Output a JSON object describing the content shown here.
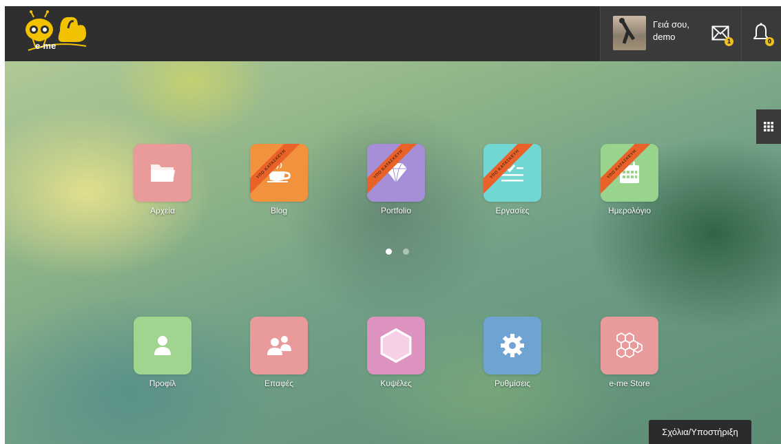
{
  "app": {
    "logo_text": "e-me"
  },
  "header": {
    "greeting_line1": "Γειά σου,",
    "greeting_line2": "demo",
    "mail_count": "1",
    "notif_count": "0"
  },
  "ribbon_text": "ΥΠΟ ΚΑΤΑΣΚΕΥΗ",
  "apps_row1": [
    {
      "label": "Αρχεία",
      "icon": "folder-icon",
      "color": "#e99b9b",
      "ribbon": false
    },
    {
      "label": "Blog",
      "icon": "coffee-cup-icon",
      "color": "#f3923d",
      "ribbon": true
    },
    {
      "label": "Portfolio",
      "icon": "diamond-icon",
      "color": "#a68fd6",
      "ribbon": true
    },
    {
      "label": "Εργασίες",
      "icon": "task-list-icon",
      "color": "#72d6d3",
      "ribbon": true
    },
    {
      "label": "Ημερολόγιο",
      "icon": "calendar-icon",
      "color": "#98d48d",
      "ribbon": true
    }
  ],
  "apps_row2": [
    {
      "label": "Προφίλ",
      "icon": "user-icon",
      "color": "#9fd58f"
    },
    {
      "label": "Επαφές",
      "icon": "contacts-icon",
      "color": "#e99b9b"
    },
    {
      "label": "Κυψέλες",
      "icon": "hexagon-icon",
      "color": "#dd93c0"
    },
    {
      "label": "Ρυθμίσεις",
      "icon": "gear-icon",
      "color": "#6ea3d2"
    },
    {
      "label": "e-me Store",
      "icon": "honeycomb-icon",
      "color": "#e99b9b"
    }
  ],
  "pager": {
    "pages": 2,
    "active": 1
  },
  "feedback_label": "Σχόλια/Υποστήριξη"
}
